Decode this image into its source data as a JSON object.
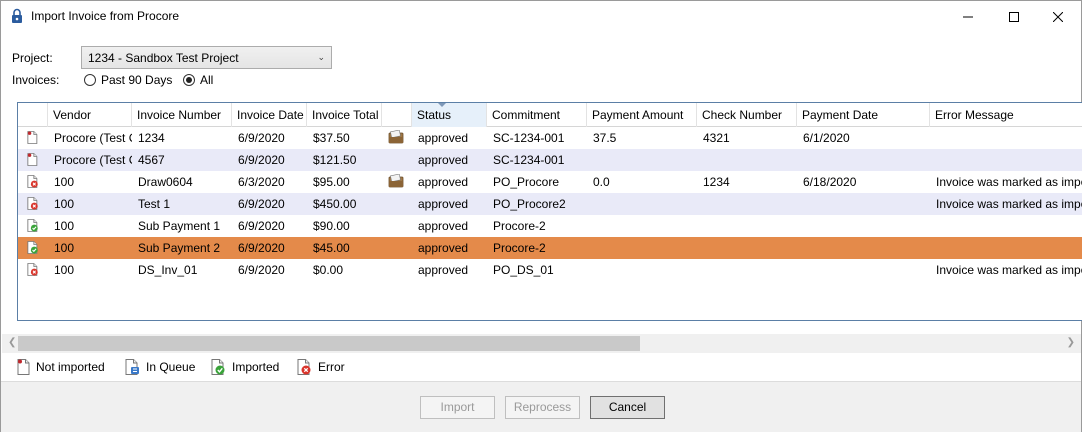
{
  "window": {
    "title": "Import Invoice from Procore"
  },
  "form": {
    "project_label": "Project:",
    "project_value": "1234 - Sandbox Test Project",
    "invoices_label": "Invoices:",
    "radio_past90": "Past 90 Days",
    "radio_all": "All",
    "selected_filter": "All"
  },
  "grid": {
    "columns": [
      "Vendor",
      "Invoice Number",
      "Invoice Date",
      "Invoice Total",
      "",
      "Status",
      "Commitment",
      "Payment Amount",
      "Check Number",
      "Payment Date",
      "Error Message"
    ],
    "sorted_column": "Status",
    "rows": [
      {
        "status_icon": "not-imported",
        "vendor": "Procore (Test C",
        "invoice_number": "1234",
        "invoice_date": "6/9/2020",
        "invoice_total": "$37.50",
        "attachment": true,
        "status": "approved",
        "commitment": "SC-1234-001",
        "payment_amount": "37.5",
        "check_number": "4321",
        "payment_date": "6/1/2020",
        "error_message": ""
      },
      {
        "status_icon": "not-imported",
        "vendor": "Procore (Test C",
        "invoice_number": "4567",
        "invoice_date": "6/9/2020",
        "invoice_total": "$121.50",
        "attachment": false,
        "status": "approved",
        "commitment": "SC-1234-001",
        "payment_amount": "",
        "check_number": "",
        "payment_date": "",
        "error_message": ""
      },
      {
        "status_icon": "error",
        "vendor": "100",
        "invoice_number": "Draw0604",
        "invoice_date": "6/3/2020",
        "invoice_total": "$95.00",
        "attachment": true,
        "status": "approved",
        "commitment": "PO_Procore",
        "payment_amount": "0.0",
        "check_number": "1234",
        "payment_date": "6/18/2020",
        "error_message": "Invoice was marked as impo"
      },
      {
        "status_icon": "error",
        "vendor": "100",
        "invoice_number": "Test 1",
        "invoice_date": "6/9/2020",
        "invoice_total": "$450.00",
        "attachment": false,
        "status": "approved",
        "commitment": "PO_Procore2",
        "payment_amount": "",
        "check_number": "",
        "payment_date": "",
        "error_message": "Invoice was marked as impo"
      },
      {
        "status_icon": "imported",
        "vendor": "100",
        "invoice_number": "Sub Payment 1",
        "invoice_date": "6/9/2020",
        "invoice_total": "$90.00",
        "attachment": false,
        "status": "approved",
        "commitment": "Procore-2",
        "payment_amount": "",
        "check_number": "",
        "payment_date": "",
        "error_message": ""
      },
      {
        "status_icon": "imported",
        "vendor": "100",
        "invoice_number": "Sub Payment 2",
        "invoice_date": "6/9/2020",
        "invoice_total": "$45.00",
        "attachment": false,
        "status": "approved",
        "commitment": "Procore-2",
        "payment_amount": "",
        "check_number": "",
        "payment_date": "",
        "error_message": ""
      },
      {
        "status_icon": "error",
        "vendor": "100",
        "invoice_number": "DS_Inv_01",
        "invoice_date": "6/9/2020",
        "invoice_total": "$0.00",
        "attachment": false,
        "status": "approved",
        "commitment": "PO_DS_01",
        "payment_amount": "",
        "check_number": "",
        "payment_date": "",
        "error_message": "Invoice was marked as impo"
      }
    ],
    "selected_row": "Sub Payment 2"
  },
  "legend": {
    "not_imported": "Not imported",
    "in_queue": "In Queue",
    "imported": "Imported",
    "error": "Error"
  },
  "buttons": {
    "import": "Import",
    "reprocess": "Reprocess",
    "cancel": "Cancel"
  },
  "colors": {
    "selected_row": "#e48a4a",
    "alt_row": "#e9eaf8",
    "grid_border": "#5b7fa6",
    "error_red": "#d9342b",
    "imported_green": "#3aa33a"
  }
}
